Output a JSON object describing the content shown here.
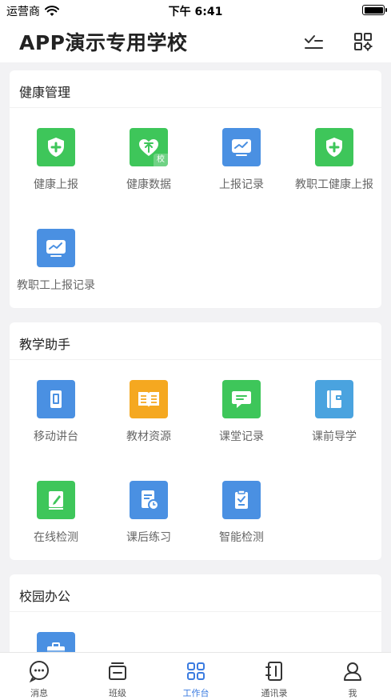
{
  "status_bar": {
    "carrier": "运营商",
    "time": "下午 6:41"
  },
  "header": {
    "title": "APP演示专用学校",
    "icons": [
      "checklist-icon",
      "grid-settings-icon"
    ]
  },
  "sections": [
    {
      "title": "健康管理",
      "items": [
        {
          "label": "健康上报",
          "icon": "shield-plus-icon",
          "color": "#3ec65a"
        },
        {
          "label": "健康数据",
          "icon": "heart-upload-icon",
          "color": "#3ec65a",
          "badge": "校"
        },
        {
          "label": "上报记录",
          "icon": "chart-board-icon",
          "color": "#4a90e2"
        },
        {
          "label": "教职工健康上报",
          "icon": "shield-plus-icon",
          "color": "#3ec65a"
        },
        {
          "label": "教职工上报记录",
          "icon": "chart-board-icon",
          "color": "#4a90e2"
        }
      ]
    },
    {
      "title": "教学助手",
      "items": [
        {
          "label": "移动讲台",
          "icon": "mobile-icon",
          "color": "#4a90e2"
        },
        {
          "label": "教材资源",
          "icon": "book-icon",
          "color": "#f5a820"
        },
        {
          "label": "课堂记录",
          "icon": "chat-bubble-icon",
          "color": "#3ec65a"
        },
        {
          "label": "课前导学",
          "icon": "notebook-icon",
          "color": "#4aa3df"
        },
        {
          "label": "在线检测",
          "icon": "pencil-paper-icon",
          "color": "#3ec65a"
        },
        {
          "label": "课后练习",
          "icon": "document-clock-icon",
          "color": "#4a90e2"
        },
        {
          "label": "智能检测",
          "icon": "clipboard-check-icon",
          "color": "#4a90e2"
        }
      ]
    },
    {
      "title": "校园办公",
      "items": [
        {
          "label": "",
          "icon": "briefcase-icon",
          "color": "#4a90e2"
        }
      ]
    }
  ],
  "tabbar": {
    "active": "工作台",
    "tabs": [
      {
        "label": "消息",
        "icon": "message-icon"
      },
      {
        "label": "班级",
        "icon": "class-icon"
      },
      {
        "label": "工作台",
        "icon": "workbench-icon"
      },
      {
        "label": "通讯录",
        "icon": "contacts-icon"
      },
      {
        "label": "我",
        "icon": "user-icon"
      }
    ]
  }
}
